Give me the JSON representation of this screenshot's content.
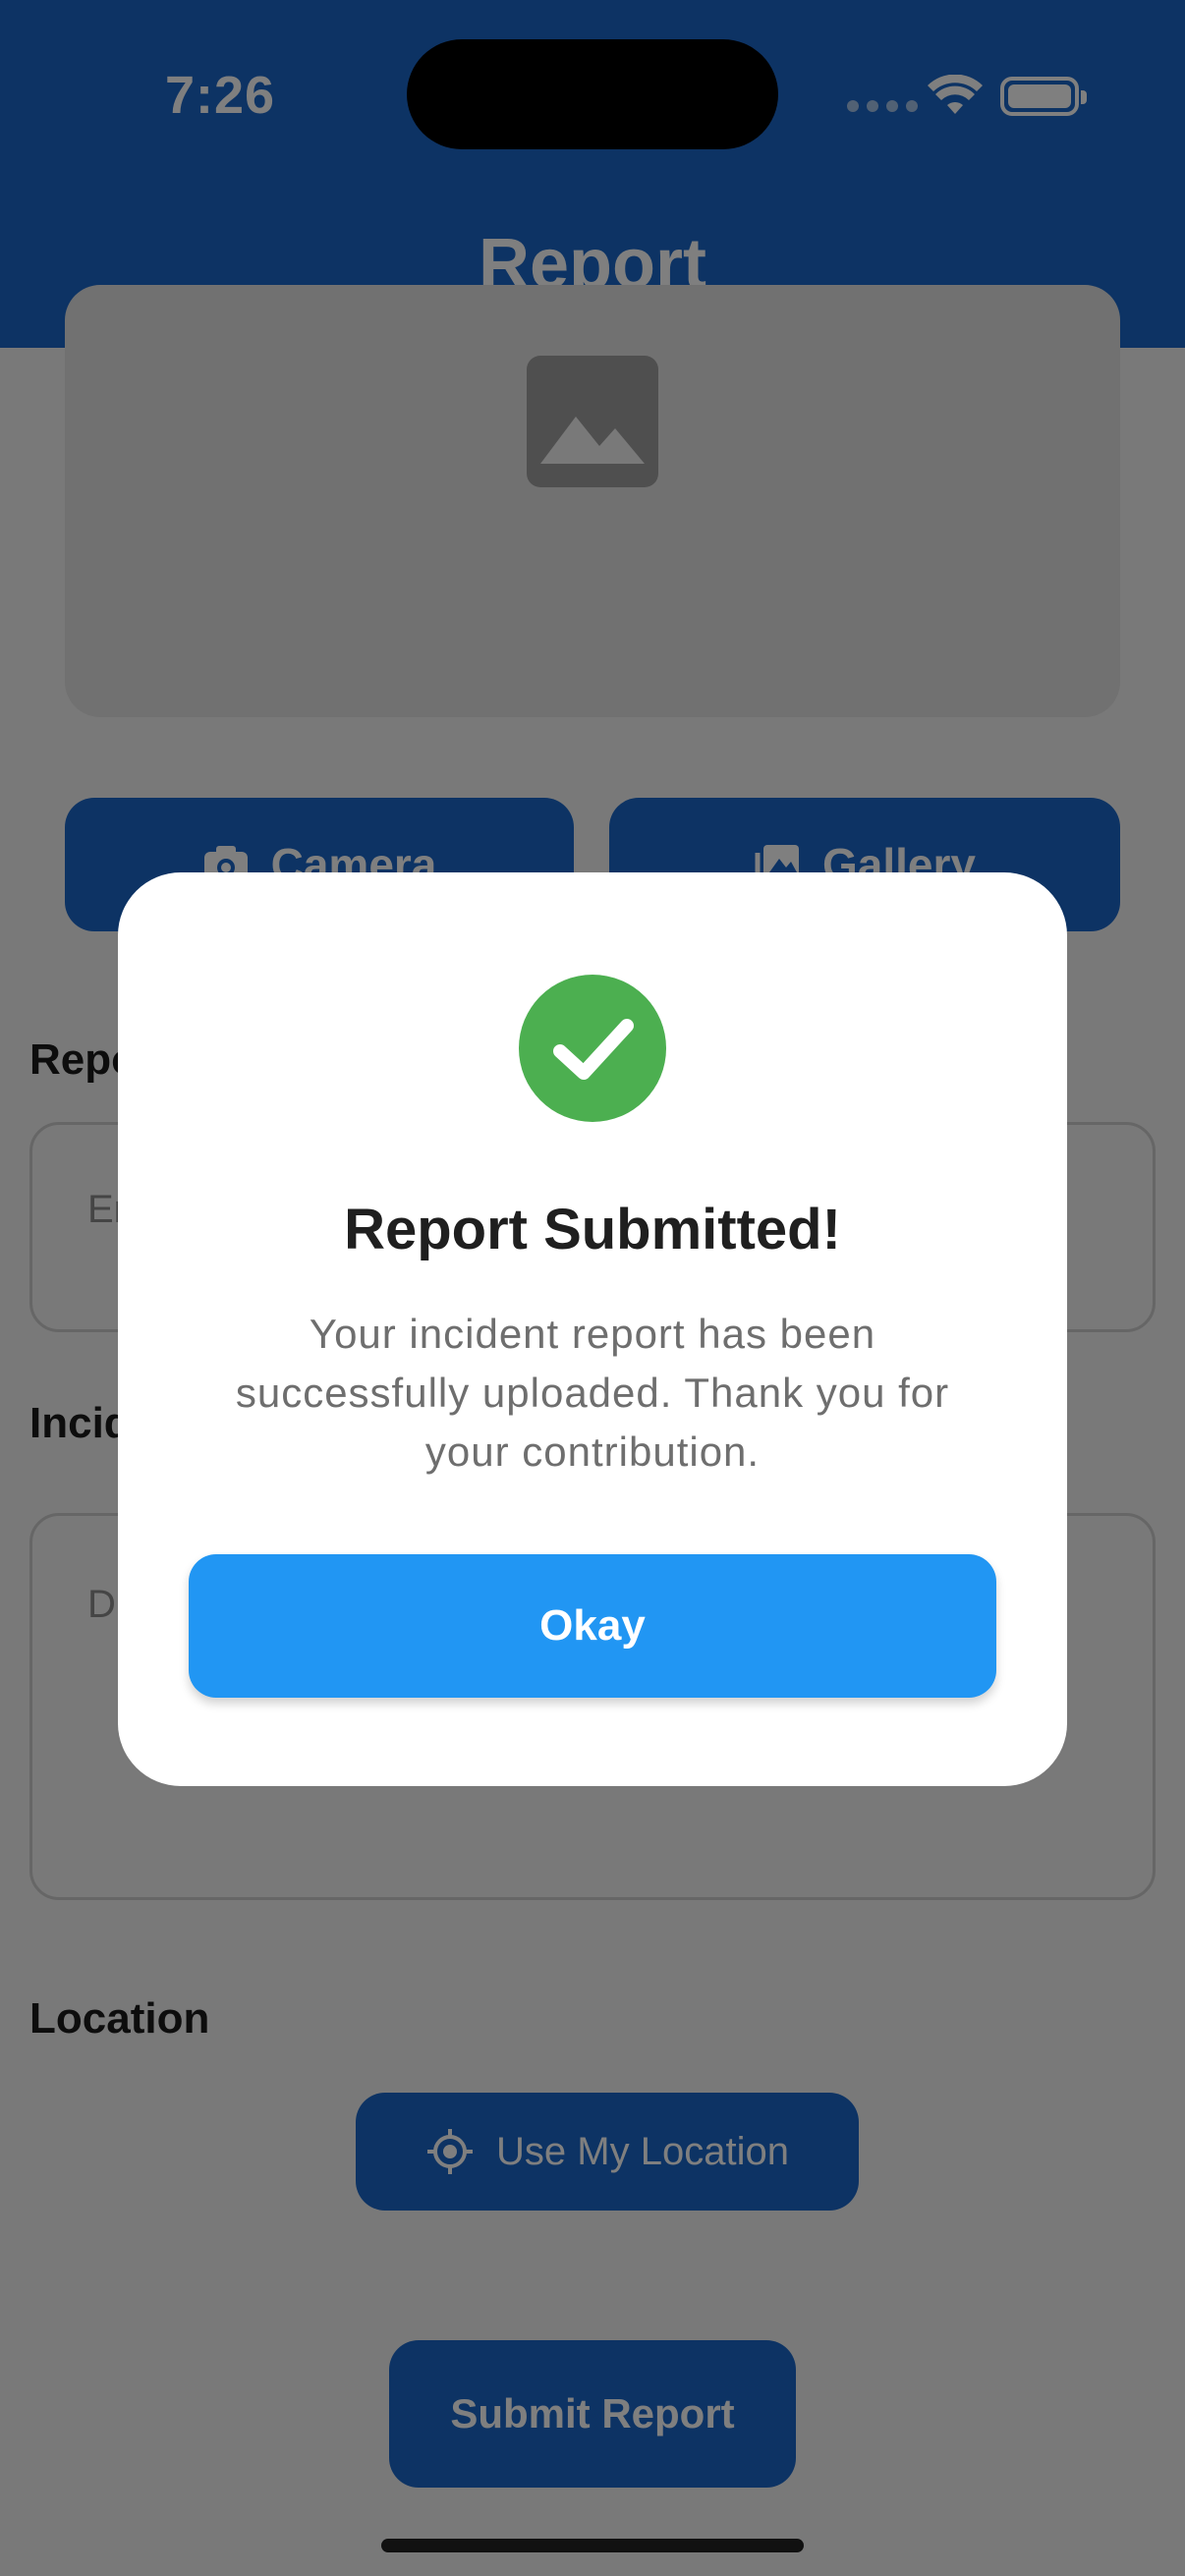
{
  "status_bar": {
    "time": "7:26"
  },
  "app_bar": {
    "title": "Report"
  },
  "media": {
    "camera_label": "Camera",
    "gallery_label": "Gallery"
  },
  "form": {
    "title_label": "Repo",
    "title_placeholder": "En",
    "incident_label": "Incid",
    "description_placeholder": "D",
    "location_label": "Location",
    "use_location_label": "Use My Location",
    "submit_label": "Submit Report"
  },
  "dialog": {
    "title": "Report Submitted!",
    "message": "Your incident report has been successfully uploaded. Thank you for your contribution.",
    "okay_label": "Okay"
  },
  "colors": {
    "app_bar": "#1b67c9",
    "primary_button": "#1b67c9",
    "success": "#4caf50",
    "okay_button": "#2196f3"
  },
  "icons": [
    "image-placeholder-icon",
    "camera-icon",
    "gallery-icon",
    "crosshair-icon",
    "check-icon",
    "wifi-icon",
    "battery-icon"
  ]
}
